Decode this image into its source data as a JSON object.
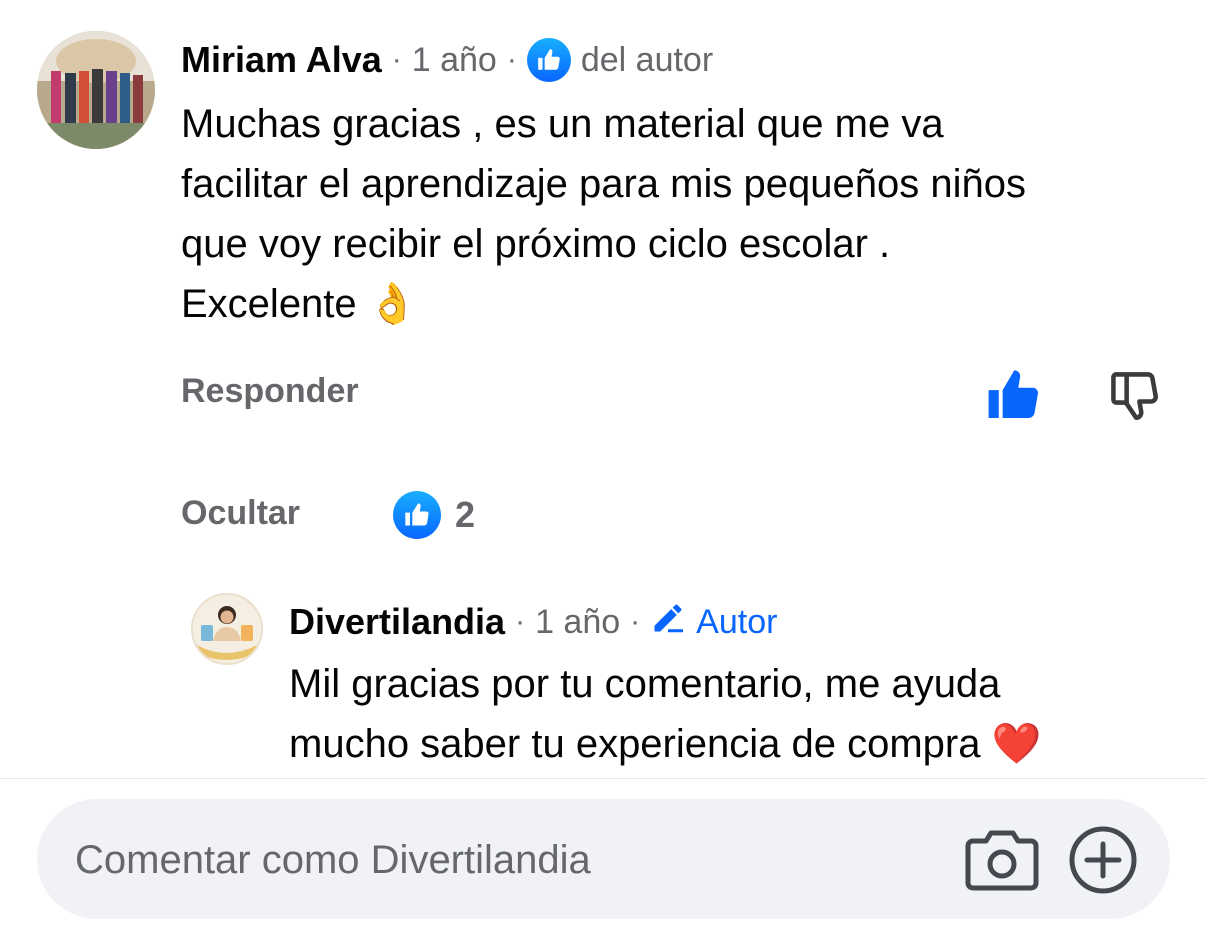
{
  "comment": {
    "author": "Miriam Alva",
    "time": "1 año",
    "separator": "·",
    "author_reaction_label": "del autor",
    "text_lines": [
      "Muchas gracias , es un material que me va",
      "facilitar el aprendizaje para mis pequeños  niños",
      "que voy  recibir el próximo ciclo escolar  .",
      "Excelente 👌"
    ],
    "reply_label": "Responder",
    "hide_label": "Ocultar",
    "reaction_count": "2"
  },
  "reply": {
    "author": "Divertilandia",
    "time": "1 año",
    "separator": "·",
    "badge_label": "Autor",
    "text_lines": [
      "Mil gracias por tu comentario, me ayuda",
      "mucho saber tu experiencia de compra ❤️"
    ]
  },
  "composer": {
    "placeholder": "Comentar como Divertilandia"
  },
  "colors": {
    "accent": "#0866ff",
    "secondary_text": "#65676b",
    "composer_bg": "#f0f2f5"
  },
  "icons": [
    "like-icon",
    "dislike-icon",
    "edit-pencil-icon",
    "camera-icon",
    "add-circle-icon"
  ]
}
